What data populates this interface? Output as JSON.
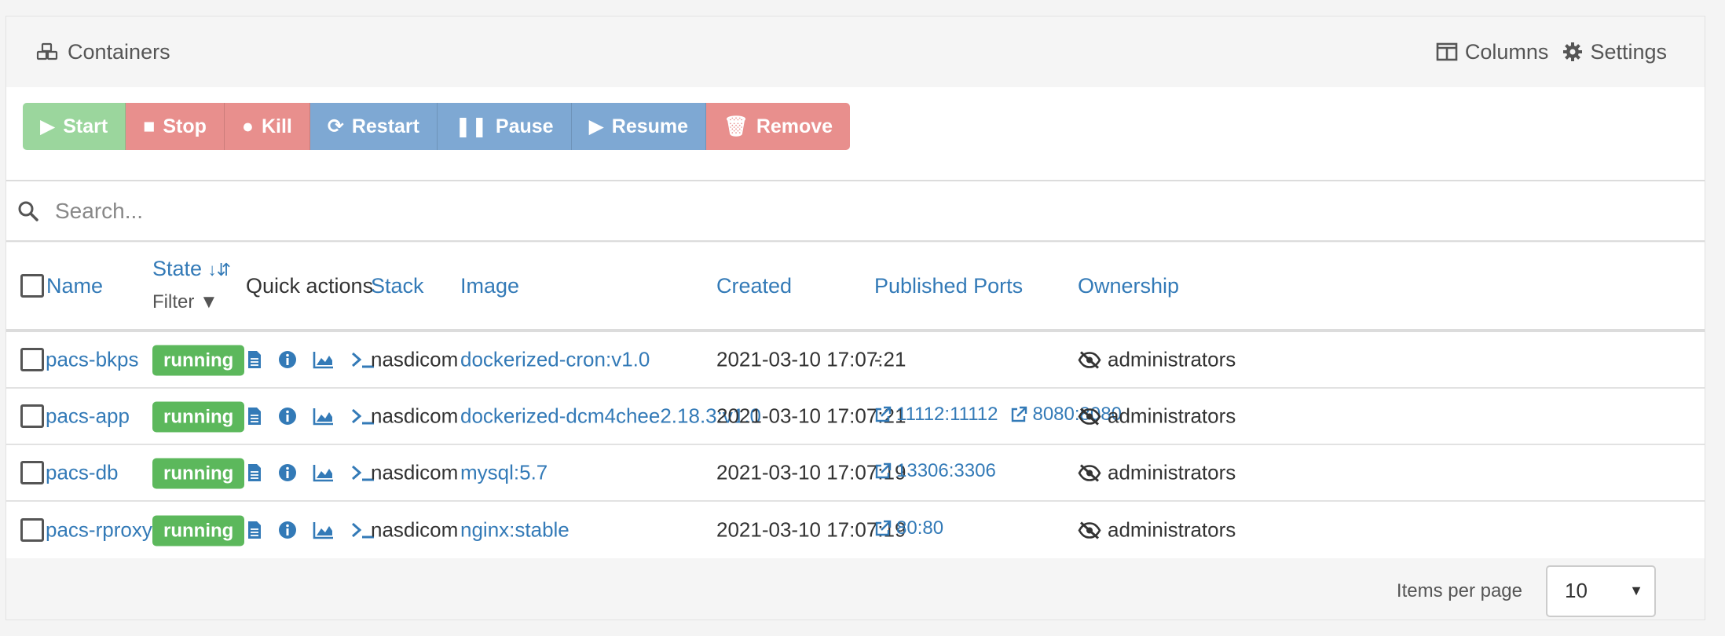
{
  "header": {
    "title": "Containers",
    "columns_label": "Columns",
    "settings_label": "Settings"
  },
  "toolbar": {
    "start": "Start",
    "stop": "Stop",
    "kill": "Kill",
    "restart": "Restart",
    "pause": "Pause",
    "resume": "Resume",
    "remove": "Remove"
  },
  "search": {
    "placeholder": "Search..."
  },
  "table": {
    "headers": {
      "name": "Name",
      "state": "State",
      "filter": "Filter",
      "quick_actions": "Quick actions",
      "stack": "Stack",
      "image": "Image",
      "created": "Created",
      "published_ports": "Published Ports",
      "ownership": "Ownership"
    },
    "rows": [
      {
        "name": "pacs-bkps",
        "state": "running",
        "stack": "nasdicom",
        "image": "dockerized-cron:v1.0",
        "created": "2021-03-10 17:07:21",
        "ports": [
          "-"
        ],
        "ownership": "administrators"
      },
      {
        "name": "pacs-app",
        "state": "running",
        "stack": "nasdicom",
        "image": "dockerized-dcm4chee2.18.3:v1.0",
        "created": "2021-03-10 17:07:21",
        "ports": [
          "11112:11112",
          "8080:8080"
        ],
        "ownership": "administrators"
      },
      {
        "name": "pacs-db",
        "state": "running",
        "stack": "nasdicom",
        "image": "mysql:5.7",
        "created": "2021-03-10 17:07:19",
        "ports": [
          "13306:3306"
        ],
        "ownership": "administrators"
      },
      {
        "name": "pacs-rproxy",
        "state": "running",
        "stack": "nasdicom",
        "image": "nginx:stable",
        "created": "2021-03-10 17:07:19",
        "ports": [
          "80:80"
        ],
        "ownership": "administrators"
      }
    ]
  },
  "footer": {
    "items_per_page_label": "Items per page",
    "items_per_page_value": "10"
  },
  "colors": {
    "link": "#337ab7",
    "running": "#5cb85c",
    "start": "#9bd69d",
    "danger": "#e88f8d",
    "info": "#7ea8d3"
  }
}
